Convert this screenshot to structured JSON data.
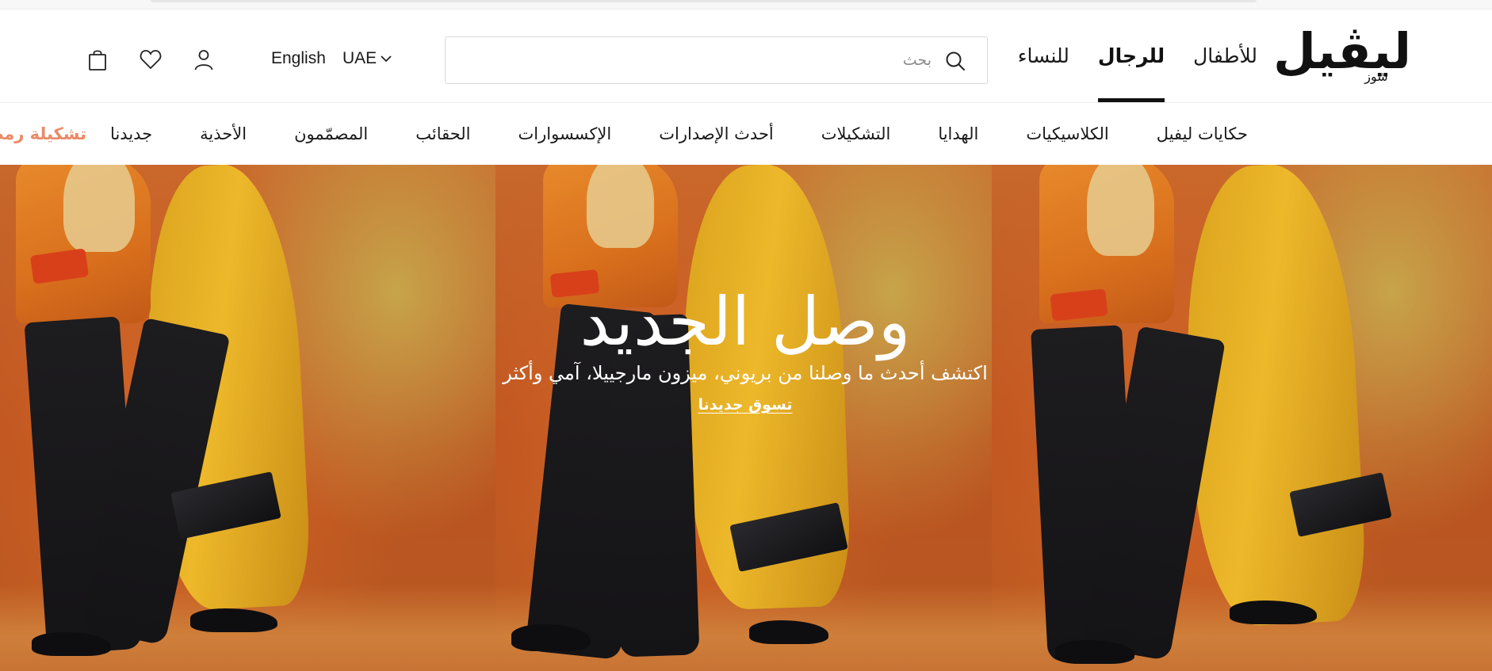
{
  "logo": {
    "main": "ليڤيل",
    "sub": "شوز"
  },
  "gender_tabs": [
    {
      "label": "للنساء",
      "active": false
    },
    {
      "label": "للرجال",
      "active": true
    },
    {
      "label": "للأطفال",
      "active": false
    }
  ],
  "search": {
    "placeholder": "بحث",
    "value": "",
    "icon": "search-icon"
  },
  "region": {
    "label": "UAE",
    "icon": "chevron-down-icon"
  },
  "language": {
    "label": "English"
  },
  "header_icons": [
    "user-icon",
    "heart-icon",
    "shopping-bag-icon"
  ],
  "categories": [
    {
      "label": "تشكيلة رمضان",
      "highlight": true
    },
    {
      "label": "جديدنا",
      "highlight": false
    },
    {
      "label": "الأحذية",
      "highlight": false
    },
    {
      "label": "المصمّمون",
      "highlight": false
    },
    {
      "label": "الحقائب",
      "highlight": false
    },
    {
      "label": "الإكسسوارات",
      "highlight": false
    },
    {
      "label": "أحدث الإصدارات",
      "highlight": false
    },
    {
      "label": "التشكيلات",
      "highlight": false
    },
    {
      "label": "الهدايا",
      "highlight": false
    },
    {
      "label": "الكلاسيكيات",
      "highlight": false
    },
    {
      "label": "حكايات ليفيل",
      "highlight": false
    }
  ],
  "hero": {
    "title": "وصل الجديد",
    "subtitle": "اكتشف أحدث ما وصلنا من بريوني، ميزون مارجييلا، آمي وأكثر",
    "cta": "تسوق جديدنا"
  },
  "colors": {
    "accent": "#ea8a66",
    "text": "#1a1a1a",
    "hero_bg": "#c65c24"
  }
}
